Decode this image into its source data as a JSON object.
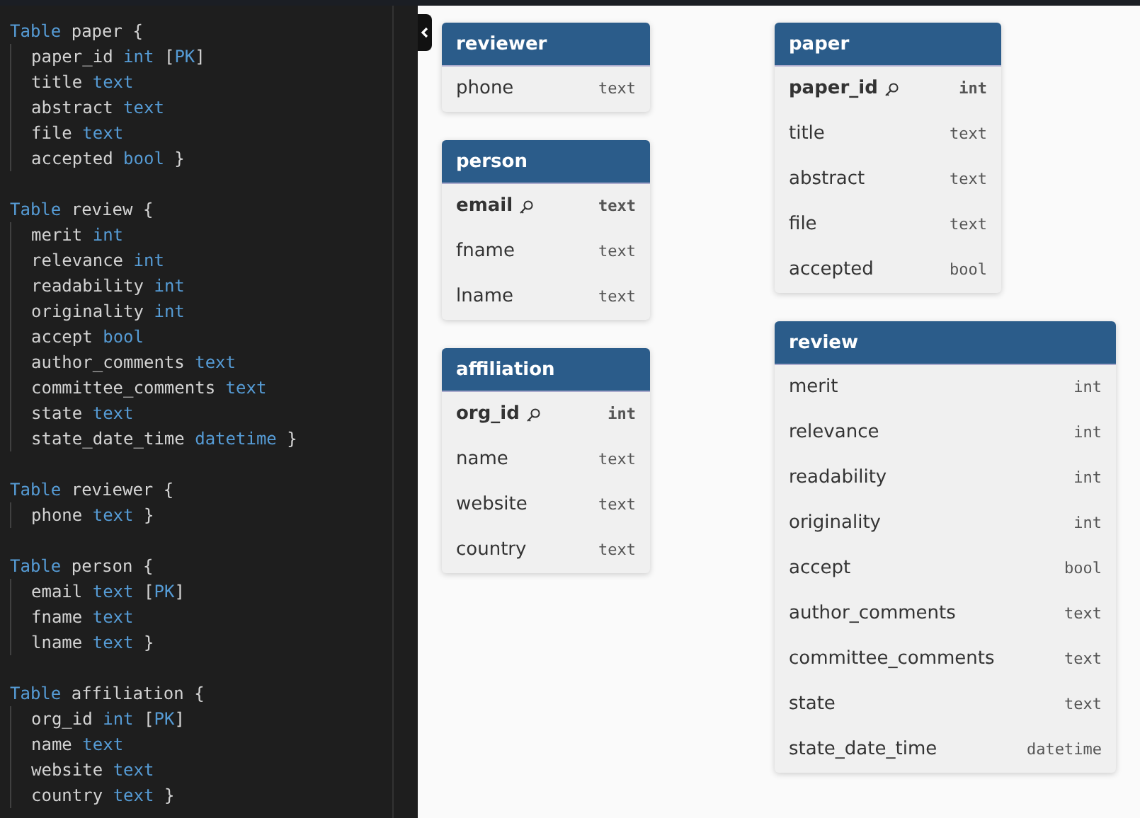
{
  "editor": {
    "blocks": [
      {
        "lines": [
          [
            {
              "t": "Table",
              "kind": "keyword"
            },
            {
              "t": "paper"
            },
            {
              "t": "{"
            }
          ],
          [
            {
              "t": "paper_id"
            },
            {
              "t": "int",
              "kind": "keyword"
            },
            {
              "t": "["
            },
            {
              "t": "PK",
              "kind": "keyword",
              "tight": true
            },
            {
              "t": "]",
              "tight": true
            }
          ],
          [
            {
              "t": "title"
            },
            {
              "t": "text",
              "kind": "keyword"
            }
          ],
          [
            {
              "t": "abstract"
            },
            {
              "t": "text",
              "kind": "keyword"
            }
          ],
          [
            {
              "t": "file"
            },
            {
              "t": "text",
              "kind": "keyword"
            }
          ],
          [
            {
              "t": "accepted"
            },
            {
              "t": "bool",
              "kind": "keyword"
            },
            {
              "t": "}"
            }
          ]
        ]
      },
      {
        "lines": [
          [
            {
              "t": "Table",
              "kind": "keyword"
            },
            {
              "t": "review"
            },
            {
              "t": "{"
            }
          ],
          [
            {
              "t": "merit"
            },
            {
              "t": "int",
              "kind": "keyword"
            }
          ],
          [
            {
              "t": "relevance"
            },
            {
              "t": "int",
              "kind": "keyword"
            }
          ],
          [
            {
              "t": "readability"
            },
            {
              "t": "int",
              "kind": "keyword"
            }
          ],
          [
            {
              "t": "originality"
            },
            {
              "t": "int",
              "kind": "keyword"
            }
          ],
          [
            {
              "t": "accept"
            },
            {
              "t": "bool",
              "kind": "keyword"
            }
          ],
          [
            {
              "t": "author_comments"
            },
            {
              "t": "text",
              "kind": "keyword"
            }
          ],
          [
            {
              "t": "committee_comments"
            },
            {
              "t": "text",
              "kind": "keyword"
            }
          ],
          [
            {
              "t": "state"
            },
            {
              "t": "text",
              "kind": "keyword"
            }
          ],
          [
            {
              "t": "state_date_time"
            },
            {
              "t": "datetime",
              "kind": "keyword"
            },
            {
              "t": "}"
            }
          ]
        ]
      },
      {
        "lines": [
          [
            {
              "t": "Table",
              "kind": "keyword"
            },
            {
              "t": "reviewer"
            },
            {
              "t": "{"
            }
          ],
          [
            {
              "t": "phone"
            },
            {
              "t": "text",
              "kind": "keyword"
            },
            {
              "t": "}"
            }
          ]
        ]
      },
      {
        "lines": [
          [
            {
              "t": "Table",
              "kind": "keyword"
            },
            {
              "t": "person"
            },
            {
              "t": "{"
            }
          ],
          [
            {
              "t": "email"
            },
            {
              "t": "text",
              "kind": "keyword"
            },
            {
              "t": "["
            },
            {
              "t": "PK",
              "kind": "keyword",
              "tight": true
            },
            {
              "t": "]",
              "tight": true
            }
          ],
          [
            {
              "t": "fname"
            },
            {
              "t": "text",
              "kind": "keyword"
            }
          ],
          [
            {
              "t": "lname"
            },
            {
              "t": "text",
              "kind": "keyword"
            },
            {
              "t": "}"
            }
          ]
        ]
      },
      {
        "lines": [
          [
            {
              "t": "Table",
              "kind": "keyword"
            },
            {
              "t": "affiliation"
            },
            {
              "t": "{"
            }
          ],
          [
            {
              "t": "org_id"
            },
            {
              "t": "int",
              "kind": "keyword"
            },
            {
              "t": "["
            },
            {
              "t": "PK",
              "kind": "keyword",
              "tight": true
            },
            {
              "t": "]",
              "tight": true
            }
          ],
          [
            {
              "t": "name"
            },
            {
              "t": "text",
              "kind": "keyword"
            }
          ],
          [
            {
              "t": "website"
            },
            {
              "t": "text",
              "kind": "keyword"
            }
          ],
          [
            {
              "t": "country"
            },
            {
              "t": "text",
              "kind": "keyword"
            },
            {
              "t": "}"
            }
          ]
        ]
      }
    ]
  },
  "diagram": {
    "tables": [
      {
        "name": "reviewer",
        "fields": [
          {
            "name": "phone",
            "type": "text",
            "pk": false
          }
        ]
      },
      {
        "name": "person",
        "fields": [
          {
            "name": "email",
            "type": "text",
            "pk": true
          },
          {
            "name": "fname",
            "type": "text",
            "pk": false
          },
          {
            "name": "lname",
            "type": "text",
            "pk": false
          }
        ]
      },
      {
        "name": "affiliation",
        "fields": [
          {
            "name": "org_id",
            "type": "int",
            "pk": true
          },
          {
            "name": "name",
            "type": "text",
            "pk": false
          },
          {
            "name": "website",
            "type": "text",
            "pk": false
          },
          {
            "name": "country",
            "type": "text",
            "pk": false
          }
        ]
      },
      {
        "name": "paper",
        "fields": [
          {
            "name": "paper_id",
            "type": "int",
            "pk": true
          },
          {
            "name": "title",
            "type": "text",
            "pk": false
          },
          {
            "name": "abstract",
            "type": "text",
            "pk": false
          },
          {
            "name": "file",
            "type": "text",
            "pk": false
          },
          {
            "name": "accepted",
            "type": "bool",
            "pk": false
          }
        ]
      },
      {
        "name": "review",
        "fields": [
          {
            "name": "merit",
            "type": "int",
            "pk": false
          },
          {
            "name": "relevance",
            "type": "int",
            "pk": false
          },
          {
            "name": "readability",
            "type": "int",
            "pk": false
          },
          {
            "name": "originality",
            "type": "int",
            "pk": false
          },
          {
            "name": "accept",
            "type": "bool",
            "pk": false
          },
          {
            "name": "author_comments",
            "type": "text",
            "pk": false
          },
          {
            "name": "committee_comments",
            "type": "text",
            "pk": false
          },
          {
            "name": "state",
            "type": "text",
            "pk": false
          },
          {
            "name": "state_date_time",
            "type": "datetime",
            "pk": false
          }
        ]
      }
    ]
  }
}
